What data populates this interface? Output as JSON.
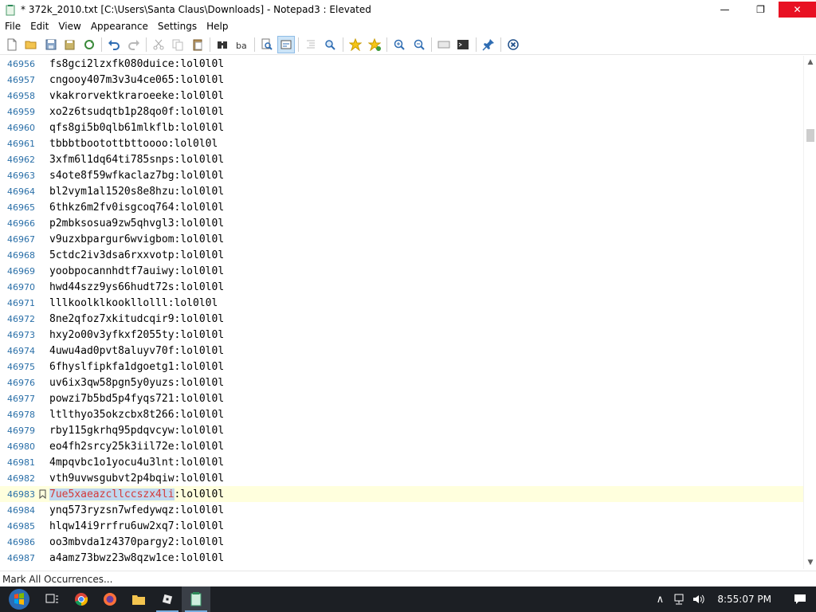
{
  "window": {
    "title": "* 372k_2010.txt [C:\\Users\\Santa Claus\\Downloads] - Notepad3 : Elevated",
    "minimize_label": "—",
    "maximize_label": "❐",
    "close_label": "✕"
  },
  "menu": [
    "File",
    "Edit",
    "View",
    "Appearance",
    "Settings",
    "Help"
  ],
  "toolbar_icons": [
    "new-file-icon",
    "open-folder-icon",
    "save-icon",
    "save-as-icon",
    "reload-icon",
    "undo-icon",
    "redo-icon",
    "cut-icon",
    "copy-icon",
    "paste-icon",
    "find-icon",
    "replace-icon",
    "find-in-files-icon",
    "word-wrap-icon",
    "indent-icon",
    "find-next-icon",
    "add-favorite-icon",
    "favorites-icon",
    "zoom-in-icon",
    "zoom-out-icon",
    "show-special-chars-icon",
    "terminal-icon",
    "pin-icon",
    "exit-icon"
  ],
  "editor": {
    "lines": [
      {
        "num": "46956",
        "text": "fs8gci2lzxfk080duice:lol0l0l"
      },
      {
        "num": "46957",
        "text": "cngooy407m3v3u4ce065:lol0l0l"
      },
      {
        "num": "46958",
        "text": "vkakrorvektkraroeeke:lol0l0l"
      },
      {
        "num": "46959",
        "text": "xo2z6tsudqtb1p28qo0f:lol0l0l"
      },
      {
        "num": "46960",
        "text": "qfs8gi5b0qlb61mlkflb:lol0l0l"
      },
      {
        "num": "46961",
        "text": "tbbbtbootottbttoooo:lol0l0l"
      },
      {
        "num": "46962",
        "text": "3xfm6l1dq64ti785snps:lol0l0l"
      },
      {
        "num": "46963",
        "text": "s4ote8f59wfkaclaz7bg:lol0l0l"
      },
      {
        "num": "46964",
        "text": "bl2vym1al1520s8e8hzu:lol0l0l"
      },
      {
        "num": "46965",
        "text": "6thkz6m2fv0isgcoq764:lol0l0l"
      },
      {
        "num": "46966",
        "text": "p2mbksosua9zw5qhvgl3:lol0l0l"
      },
      {
        "num": "46967",
        "text": "v9uzxbpargur6wvigbom:lol0l0l"
      },
      {
        "num": "46968",
        "text": "5ctdc2iv3dsa6rxxvotp:lol0l0l"
      },
      {
        "num": "46969",
        "text": "yoobpocannhdtf7auiwy:lol0l0l"
      },
      {
        "num": "46970",
        "text": "hwd44szz9ys66hudt72s:lol0l0l"
      },
      {
        "num": "46971",
        "text": "lllkoolklkookllolll:lol0l0l"
      },
      {
        "num": "46972",
        "text": "8ne2qfoz7xkitudcqir9:lol0l0l"
      },
      {
        "num": "46973",
        "text": "hxy2o00v3yfkxf2055ty:lol0l0l"
      },
      {
        "num": "46974",
        "text": "4uwu4ad0pvt8aluyv70f:lol0l0l"
      },
      {
        "num": "46975",
        "text": "6fhyslfipkfa1dgoetg1:lol0l0l"
      },
      {
        "num": "46976",
        "text": "uv6ix3qw58pgn5y0yuzs:lol0l0l"
      },
      {
        "num": "46977",
        "text": "powzi7b5bd5p4fyqs721:lol0l0l"
      },
      {
        "num": "46978",
        "text": "ltlthyo35okzcbx8t266:lol0l0l"
      },
      {
        "num": "46979",
        "text": "rby115gkrhq95pdqvcyw:lol0l0l"
      },
      {
        "num": "46980",
        "text": "eo4fh2srcy25k3iil72e:lol0l0l"
      },
      {
        "num": "46981",
        "text": "4mpqvbc1o1yocu4u3lnt:lol0l0l"
      },
      {
        "num": "46982",
        "text": "vth9uvwsgubvt2p4bqiw:lol0l0l"
      },
      {
        "num": "46983",
        "text": ":lol0l0l",
        "selected": "7ue5xaeazcllccszx4li",
        "bookmark": true
      },
      {
        "num": "46984",
        "text": "ynq573ryzsn7wfedywqz:lol0l0l"
      },
      {
        "num": "46985",
        "text": "hlqw14i9rrfru6uw2xq7:lol0l0l"
      },
      {
        "num": "46986",
        "text": "oo3mbvda1z4370pargy2:lol0l0l"
      },
      {
        "num": "46987",
        "text": "a4amz73bwz23w8qzw1ce:lol0l0l"
      }
    ]
  },
  "statusbar": {
    "text": "Mark All Occurrences..."
  },
  "taskbar": {
    "apps": [
      "start-icon",
      "task-view-icon",
      "chrome-icon",
      "firefox-icon",
      "file-explorer-icon",
      "roblox-icon",
      "notepad3-icon"
    ],
    "clock": "8:55:07 PM"
  }
}
